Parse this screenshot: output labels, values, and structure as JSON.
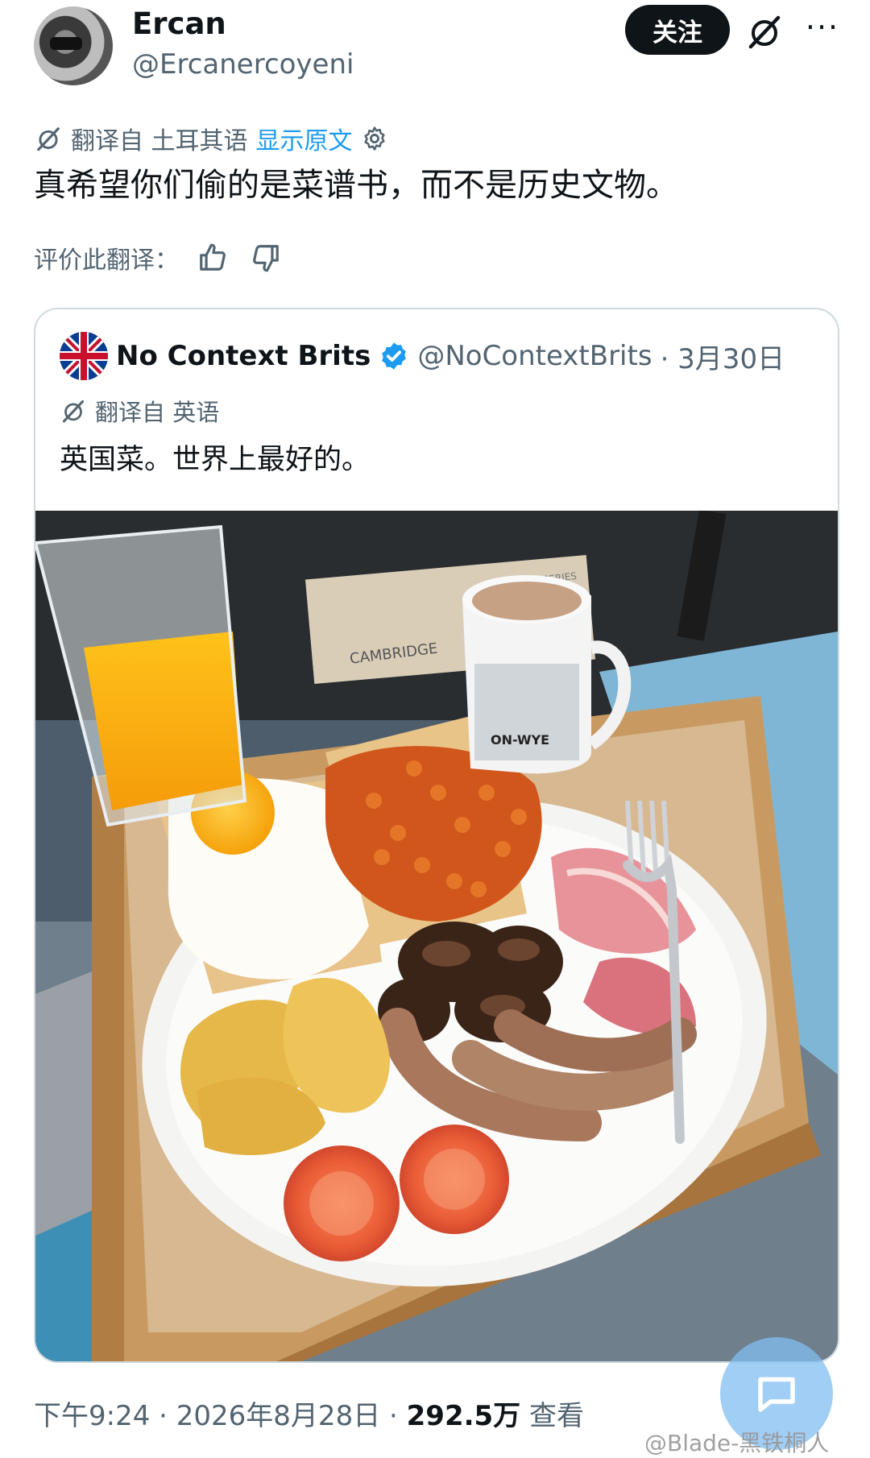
{
  "author": {
    "name": "Ercan",
    "handle": "@Ercanercoyeni"
  },
  "actions": {
    "follow_label": "关注",
    "more_label": "···",
    "grok_icon": "grok-icon"
  },
  "translation": {
    "from_label": "翻译自 土耳其语",
    "show_original_label": "显示原文"
  },
  "post": {
    "text": "真希望你们偷的是菜谱书，而不是历史文物。"
  },
  "rate": {
    "label": "评价此翻译："
  },
  "quoted": {
    "name": "No Context Brits",
    "handle": "@NoContextBrits",
    "date": "· 3月30日",
    "translation_label": "翻译自 英语",
    "text": "英国菜。世界上最好的。",
    "photo_text": {
      "box_brand": "CAMBRIDGE",
      "box_series": "CX SERIES",
      "mug_text": "ON-WYE"
    }
  },
  "footer": {
    "time": "下午9:24 · 2026年8月28日 · ",
    "views": "292.5万",
    "views_label": " 查看"
  },
  "watermark": "@Blade-黑铁桐人",
  "colors": {
    "accent": "#1d9bf0",
    "text": "#0f1419",
    "muted": "#536471",
    "verified": "#1d9bf0"
  }
}
